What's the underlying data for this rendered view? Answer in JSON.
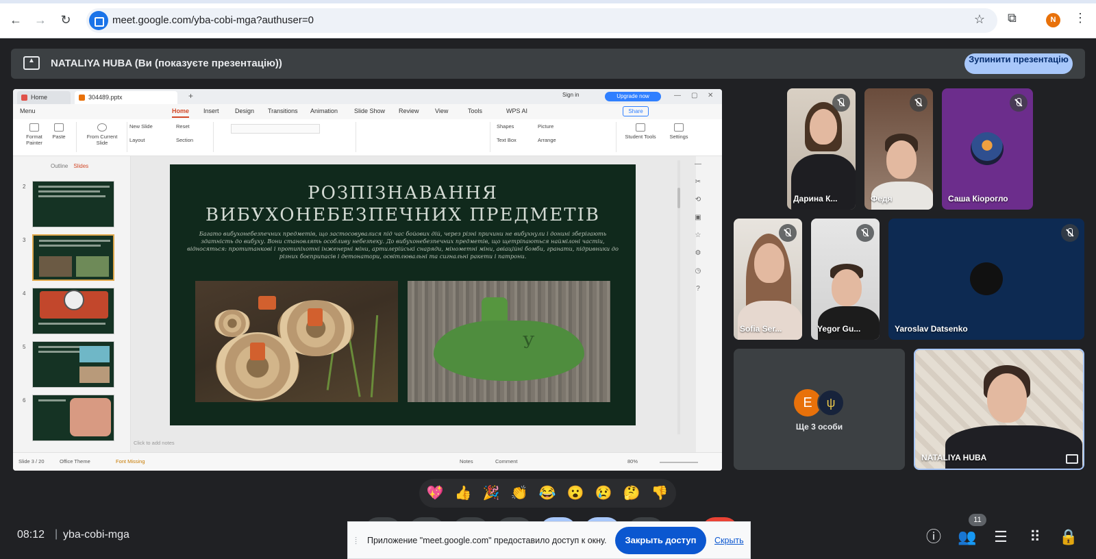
{
  "browser": {
    "url": "meet.google.com/yba-cobi-mga?authuser=0",
    "profile_initial": "N"
  },
  "presentation_banner": {
    "text": "NATALIYA HUBA (Ви (показуєте презентацію))",
    "stop_button": "Зупинити презентацію"
  },
  "wps": {
    "tab_home": "Home",
    "tab_file": "304489.pptx",
    "sign_in": "Sign in",
    "upgrade": "Upgrade now",
    "menu": [
      "Menu",
      "Home",
      "Insert",
      "Design",
      "Transitions",
      "Animation",
      "Slide Show",
      "Review",
      "View",
      "Tools",
      "WPS AI"
    ],
    "share": "Share",
    "ribbon": {
      "format_painter": "Format Painter",
      "paste": "Paste",
      "from_current": "From Current Slide",
      "new_slide": "New Slide",
      "reset": "Reset",
      "layout": "Layout",
      "section": "Section",
      "shapes": "Shapes",
      "picture": "Picture",
      "text_box": "Text Box",
      "arrange": "Arrange",
      "student_tools": "Student Tools",
      "settings": "Settings"
    },
    "panel_tabs": {
      "outline": "Outline",
      "slides": "Slides"
    },
    "thumb_numbers": [
      "2",
      "3",
      "4",
      "5",
      "6"
    ],
    "slide": {
      "title_line1": "РОЗПІЗНАВАННЯ",
      "title_line2": "ВИБУХОНЕБЕЗПЕЧНИХ ПРЕДМЕТІВ",
      "body": "Багато вибухонебезпечних предметів, що застосовувалися під час бойових дій, через різні причини не вибухнули і донині зберігають здатність до вибуху. Вони становлять особливу небезпеку. До вибухонебезпечних предметів, що щетріпаються наймілоні частіи, відносяться: протитанкові і протипіхотні інженерні міни, артилерійські снаряди, мінометні міни, авіаційні бомби, гранати, підривники до різних боєприпасів і детонатори, освітлювальні та сигнальні ракети і патрони.",
      "mark_letter": "У"
    },
    "notes_placeholder": "Click to add notes",
    "status": {
      "slide_count": "Slide 3 / 20",
      "theme": "Office Theme",
      "font_missing": "Font Missing",
      "notes": "Notes",
      "comment": "Comment",
      "zoom": "80%"
    }
  },
  "participants": [
    {
      "name": "Дарина К...",
      "muted": true
    },
    {
      "name": "Федя",
      "muted": true
    },
    {
      "name": "Саша Кіорогло",
      "muted": true
    },
    {
      "name": "Sofia Ser...",
      "muted": true
    },
    {
      "name": "Yegor Gu...",
      "muted": true
    },
    {
      "name": "Yaroslav Datsenko",
      "muted": true
    }
  ],
  "more_people": {
    "avatar_letter": "E",
    "label": "Ще 3 особи"
  },
  "self": {
    "name": "NATALIYA HUBA"
  },
  "reactions": [
    "💖",
    "👍",
    "🎉",
    "👏",
    "😂",
    "😮",
    "😢",
    "🤔",
    "👎"
  ],
  "bottom": {
    "time": "08:12",
    "separator": "|",
    "meeting_code": "yba-cobi-mga",
    "people_count": "11"
  },
  "share_notice": {
    "message": "Приложение \"meet.google.com\" предоставило доступ к окну.",
    "close_button": "Закрыть доступ",
    "hide_link": "Скрыть"
  },
  "colors": {
    "meet_bg": "#202124",
    "tile_bg": "#3c4043",
    "accent_blue": "#a8c7fa",
    "primary_blue": "#0b57d0",
    "slide_bg": "#10291c"
  }
}
